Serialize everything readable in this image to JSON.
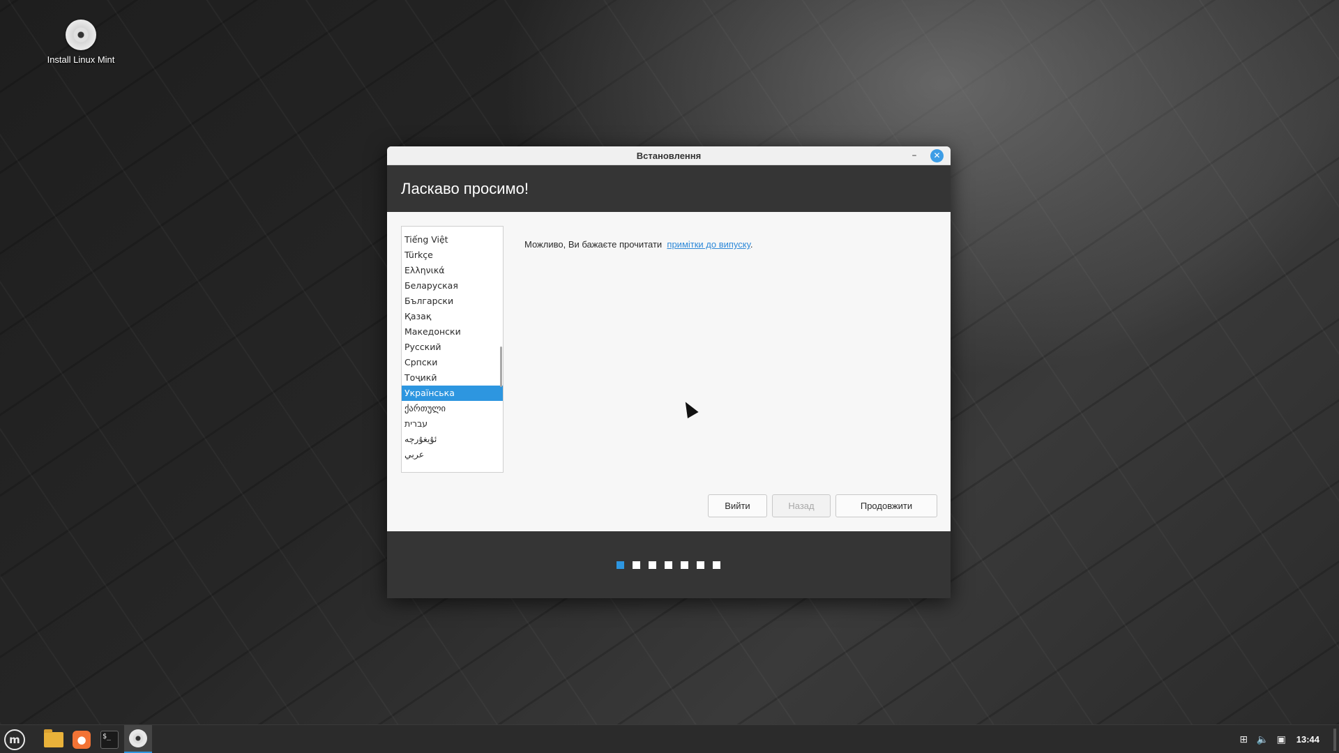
{
  "desktop": {
    "icon_label": "Install Linux Mint"
  },
  "window": {
    "title": "Встановлення",
    "minimize_glyph": "–",
    "close_glyph": "✕",
    "heading": "Ласкаво просимо!",
    "languages": [
      {
        "label": "Tiếng Việt",
        "selected": false
      },
      {
        "label": "Türkçe",
        "selected": false
      },
      {
        "label": "Ελληνικά",
        "selected": false
      },
      {
        "label": "Беларуская",
        "selected": false
      },
      {
        "label": "Български",
        "selected": false
      },
      {
        "label": "Қазақ",
        "selected": false
      },
      {
        "label": "Македонски",
        "selected": false
      },
      {
        "label": "Русский",
        "selected": false
      },
      {
        "label": "Српски",
        "selected": false
      },
      {
        "label": "Тоҷикӣ",
        "selected": false
      },
      {
        "label": "Українська",
        "selected": true
      },
      {
        "label": "ქართული",
        "selected": false
      },
      {
        "label": "עברית",
        "selected": false
      },
      {
        "label": "ئۇيغۇرچە",
        "selected": false
      },
      {
        "label": "عربي",
        "selected": false
      }
    ],
    "release_note_prefix": "Можливо, Ви бажаєте прочитати",
    "release_note_link": "примітки до випуску",
    "release_note_suffix": ".",
    "buttons": {
      "quit": "Вийти",
      "back": "Назад",
      "continue": "Продовжити"
    },
    "progress": {
      "total_steps": 7,
      "current_step": 1
    }
  },
  "taskbar": {
    "menu_glyph": "m",
    "terminal_glyph": "$_",
    "clock": "13:44"
  },
  "colors": {
    "accent": "#2d96e0",
    "header_bg": "#353535",
    "taskbar_bg": "#2b2b2b"
  }
}
